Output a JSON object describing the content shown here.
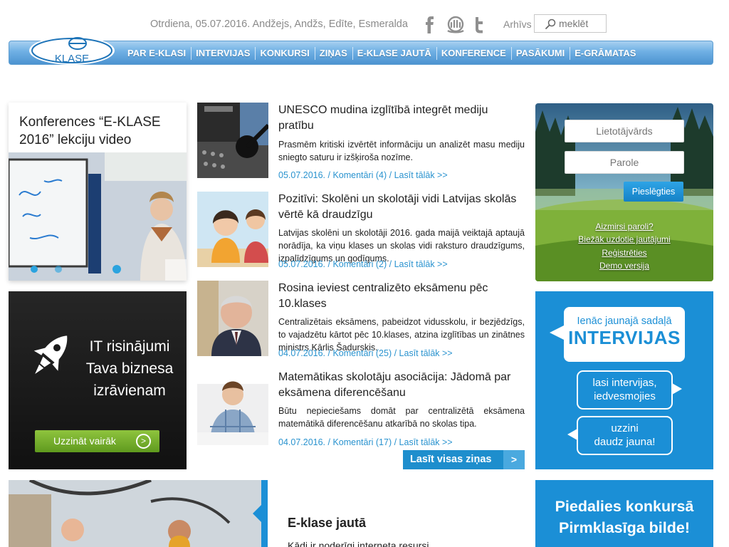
{
  "header": {
    "date_line": "Otrdiena, 05.07.2016. Andžejs, Andžs, Edīte, Esmeralda",
    "archive_label": "Arhīvs",
    "search_placeholder": "meklēt",
    "social_icons": [
      "facebook-icon",
      "draugiem-icon",
      "twitter-icon"
    ]
  },
  "logo": {
    "text": "KLASE",
    "letter": "E"
  },
  "nav": {
    "items": [
      "PAR E-KLASI",
      "INTERVIJAS",
      "KONKURSI",
      "ZIŅAS",
      "E-KLASE JAUTĀ",
      "KONFERENCE",
      "PASĀKUMI",
      "E-GRĀMATAS"
    ]
  },
  "left": {
    "conference_title": "Konferences “E-KLASE 2016” lekciju video",
    "it_text": "IT risinājumi Tava biznesa izrāvienam",
    "it_button": "Uzzināt vairāk"
  },
  "news": [
    {
      "title": "UNESCO mudina izglītībā integrēt mediju pratību",
      "summary": "Prasmēm kritiski izvērtēt informāciju un analizēt masu mediju sniegto saturu ir izšķiroša nozīme.",
      "meta": "05.07.2016. / Komentāri (4) / Lasīt tālāk >>"
    },
    {
      "title": "Pozitīvi: Skolēni un skolotāji vidi Latvijas skolās vērtē kā draudzīgu",
      "summary": "Latvijas skolēni un skolotāji 2016. gada maijā veiktajā aptaujā norādīja, ka viņu klases un skolas vidi raksturo draudzīgums, izpalīdzīgums un godīgums.",
      "meta": "05.07.2016. / Komentāri (2) / Lasīt tālāk >>"
    },
    {
      "title": "Rosina ieviest centralizēto eksāmenu pēc 10.klases",
      "summary": "Centralizētais eksāmens, pabeidzot vidusskolu, ir bezjēdzīgs, to vajadzētu kārtot pēc 10.klases, atzina izglītības un zinātnes ministrs Kārlis Šadurskis.",
      "meta": "04.07.2016. / Komentāri (25) / Lasīt tālāk >>"
    },
    {
      "title": "Matemātikas skolotāju asociācija: Jādomā par eksāmena diferencēšanu",
      "summary": "Būtu nepieciešams domāt par centralizētā eksāmena matemātikā diferencēšanu atkarībā no skolas tipa.",
      "meta": "04.07.2016. / Komentāri (17) / Lasīt tālāk >>"
    }
  ],
  "all_news": {
    "label": "Lasīt visas ziņas",
    "arrow": ">"
  },
  "login": {
    "username_placeholder": "Lietotājvārds",
    "password_placeholder": "Parole",
    "button": "Pieslēgties",
    "links": [
      "Aizmirsi paroli?",
      "Biežāk uzdotie jautājumi",
      "Reģistrēties",
      "Demo versija"
    ]
  },
  "interviews": {
    "small": "Ienāc jaunajā sadaļā",
    "big": "INTERVIJAS",
    "b2_line1": "lasi intervijas,",
    "b2_line2": "iedvesmojies",
    "b3_line1": "uzzini",
    "b3_line2": "daudz jauna!"
  },
  "contest": {
    "line1": "Piedalies konkursā",
    "line2": "Pirmklasīga bilde!"
  },
  "bottom": {
    "section_title": "E-klase jautā",
    "section_text": "Kādi ir noderīgi interneta resursi"
  },
  "colors": {
    "accent": "#1b8fd6",
    "link": "#2a93cf",
    "green": "#7ab52f"
  }
}
